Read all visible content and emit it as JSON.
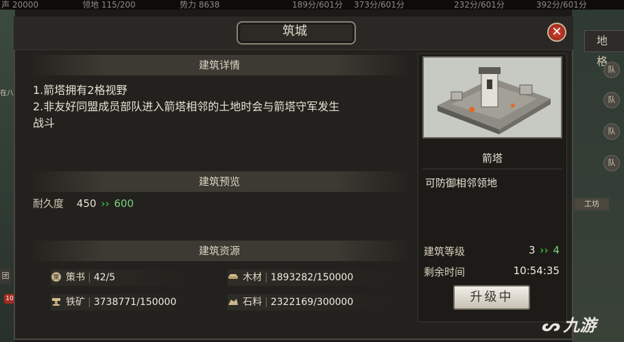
{
  "topbar": {
    "stat1": "声 20000",
    "stat2": "领地 115/200",
    "stat3": "势力 8638",
    "res1": "189分/601分",
    "res2": "373分/601分",
    "res3": "232分/601分",
    "res4": "392分/601分"
  },
  "background": {
    "right_tab": "地 格",
    "right_dot_label": "队",
    "workshop_label": "工坊",
    "left_edge_text": "在八",
    "left_button": "团",
    "left_badge": "10"
  },
  "dialog": {
    "title": "筑城",
    "close_icon": "close-icon",
    "details": {
      "heading": "建筑详情",
      "lines": [
        "1.箭塔拥有2格视野",
        "2.非友好同盟成员部队进入箭塔相邻的土地时会与箭塔守军发生",
        "战斗"
      ]
    },
    "preview": {
      "heading": "建筑预览",
      "durability_label": "耐久度",
      "durability_old": "450",
      "durability_new": "600",
      "arrow_icon": "double-chevron-right-icon"
    },
    "resources": {
      "heading": "建筑资源",
      "items": [
        {
          "icon": "strategy-book-icon",
          "name": "策书",
          "value": "42/5"
        },
        {
          "icon": "wood-icon",
          "name": "木材",
          "value": "1893282/150000"
        },
        {
          "icon": "iron-ore-icon",
          "name": "铁矿",
          "value": "3738771/150000"
        },
        {
          "icon": "stone-icon",
          "name": "石料",
          "value": "2322169/300000"
        }
      ]
    },
    "building": {
      "image_icon": "arrow-tower-illustration",
      "name": "箭塔",
      "description": "可防御相邻领地",
      "level_label": "建筑等级",
      "level_current": "3",
      "level_next": "4",
      "time_label": "剩余时间",
      "time_value": "10:54:35",
      "upgrade_button": "升级中"
    }
  },
  "watermark": {
    "text": "九游",
    "logo_icon": "jiuyou-logo-icon"
  },
  "colors": {
    "accent_green": "#37b23a",
    "new_value_green": "#7bd57e",
    "close_red": "#b8321f",
    "panel_bg": "#22211d"
  }
}
